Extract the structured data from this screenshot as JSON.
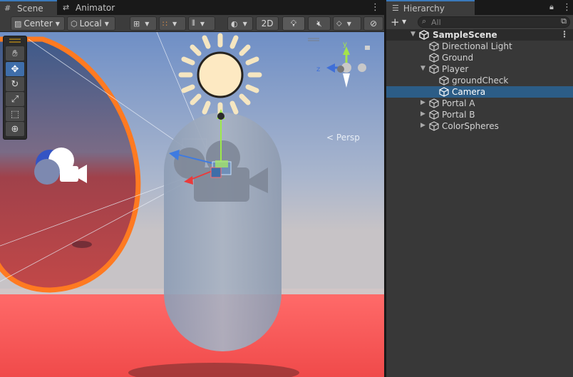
{
  "scene_tabs": [
    {
      "label": "Scene",
      "icon": "grid-icon"
    },
    {
      "label": "Animator",
      "icon": "animator-icon"
    }
  ],
  "toolbar": {
    "pivot": "Center",
    "space": "Local",
    "mode_2d": "2D"
  },
  "viewport": {
    "projection_label": "Persp",
    "gizmo_axes": {
      "y": "y",
      "z": "z"
    }
  },
  "colors": {
    "sky_top": "#7f9ccc",
    "floor": "#ff5a5a",
    "portal_ring": "#ff7a21",
    "selection_blue": "#2c5d87",
    "accent": "#3a79bb"
  },
  "hierarchy": {
    "tab_label": "Hierarchy",
    "search_placeholder": "All",
    "scene_name": "SampleScene",
    "items": [
      {
        "label": "Directional Light",
        "depth": 1,
        "foldout": false,
        "selected": false
      },
      {
        "label": "Ground",
        "depth": 1,
        "foldout": false,
        "selected": false
      },
      {
        "label": "Player",
        "depth": 1,
        "foldout": "open",
        "selected": false
      },
      {
        "label": "groundCheck",
        "depth": 2,
        "foldout": false,
        "selected": false
      },
      {
        "label": "Camera",
        "depth": 2,
        "foldout": false,
        "selected": true
      },
      {
        "label": "Portal A",
        "depth": 1,
        "foldout": "closed",
        "selected": false
      },
      {
        "label": "Portal B",
        "depth": 1,
        "foldout": "closed",
        "selected": false
      },
      {
        "label": "ColorSpheres",
        "depth": 1,
        "foldout": "closed",
        "selected": false
      }
    ]
  }
}
